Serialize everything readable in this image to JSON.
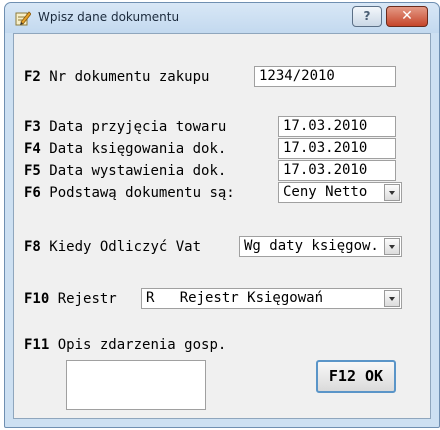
{
  "window": {
    "title": "Wpisz dane dokumentu",
    "help_label": "?",
    "close_label": "✕"
  },
  "form": {
    "f2": {
      "key": "F2",
      "label": "Nr dokumentu zakupu",
      "value": "1234/2010"
    },
    "f3": {
      "key": "F3",
      "label": "Data przyjęcia towaru",
      "value": "17.03.2010"
    },
    "f4": {
      "key": "F4",
      "label": "Data księgowania dok.",
      "value": "17.03.2010"
    },
    "f5": {
      "key": "F5",
      "label": "Data wystawienia dok.",
      "value": "17.03.2010"
    },
    "f6": {
      "key": "F6",
      "label": "Podstawą dokumentu są:",
      "value": "Ceny Netto"
    },
    "f8": {
      "key": "F8",
      "label": "Kiedy Odliczyć Vat",
      "value": "Wg daty księgow."
    },
    "f10": {
      "key": "F10",
      "label": "Rejestr",
      "value": "R   Rejestr Księgowań"
    },
    "f11": {
      "key": "F11",
      "label": "Opis zdarzenia gosp.",
      "value": ""
    },
    "ok_button": "F12 OK"
  },
  "icons": {
    "app": "notepad-pencil-icon",
    "dropdown": "chevron-down-icon"
  }
}
